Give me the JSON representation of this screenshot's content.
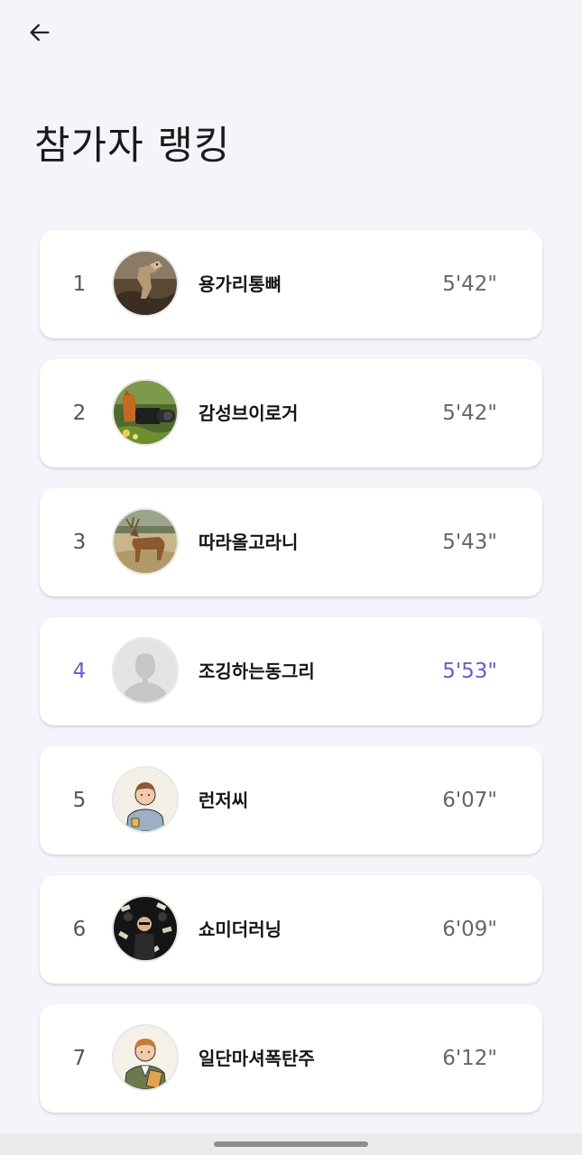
{
  "header": {
    "back_icon": "arrow-left-icon",
    "title": "참가자 랭킹"
  },
  "colors": {
    "background": "#f4f5fa",
    "highlight": "#6d5cc4"
  },
  "ranking": [
    {
      "rank": "1",
      "name": "용가리통뼈",
      "time": "5'42\"",
      "avatar": "dinosaur-photo"
    },
    {
      "rank": "2",
      "name": "감성브이로거",
      "time": "5'42\"",
      "avatar": "squirrel-camera-photo"
    },
    {
      "rank": "3",
      "name": "따라올고라니",
      "time": "5'43\"",
      "avatar": "deer-photo"
    },
    {
      "rank": "4",
      "name": "조깅하는동그리",
      "time": "5'53\"",
      "avatar": "default-person",
      "highlighted": true
    },
    {
      "rank": "5",
      "name": "런저씨",
      "time": "6'07\"",
      "avatar": "man-illustration"
    },
    {
      "rank": "6",
      "name": "쇼미더러닝",
      "time": "6'09\"",
      "avatar": "money-party-photo"
    },
    {
      "rank": "7",
      "name": "일단마셔폭탄주",
      "time": "6'12\"",
      "avatar": "man-clipboard-illustration"
    }
  ]
}
